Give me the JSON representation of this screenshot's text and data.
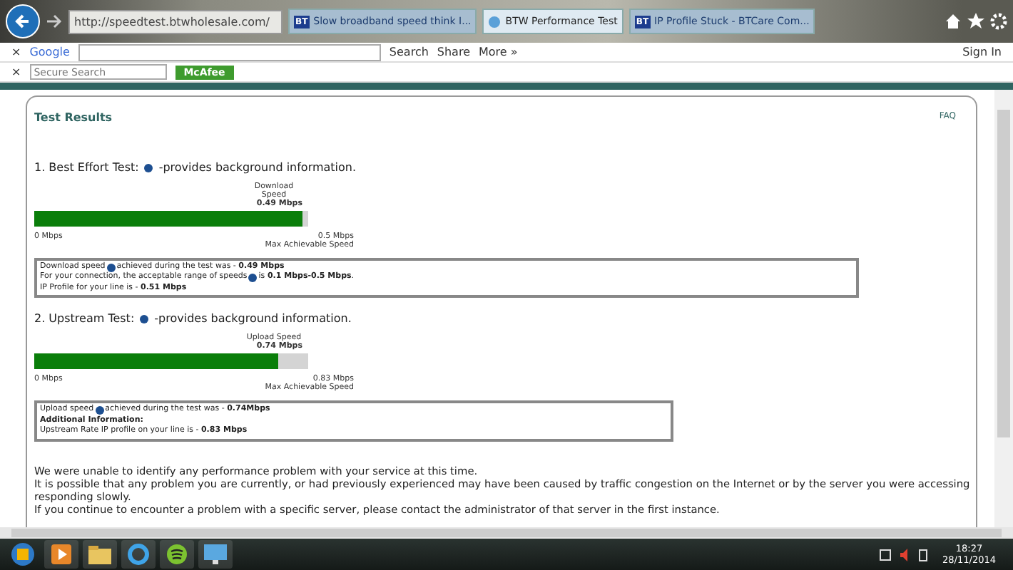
{
  "browser": {
    "address": "http://speedtest.btwholesale.com/",
    "tabs": [
      {
        "label": "Slow broadband speed think I...",
        "selected": false,
        "badge": "BT"
      },
      {
        "label": "BTW Performance Test",
        "selected": true
      },
      {
        "label": "IP Profile Stuck - BTCare Com...",
        "selected": false,
        "badge": "BT"
      }
    ]
  },
  "google_toolbar": {
    "close": "×",
    "brand": "Google",
    "search": "Search",
    "share": "Share",
    "more": "More »",
    "sign_in": "Sign In"
  },
  "mcafee_toolbar": {
    "close": "×",
    "placeholder": "Secure Search",
    "brand": "McAfee"
  },
  "page": {
    "title": "Test Results",
    "faq": "FAQ",
    "tests": [
      {
        "heading": "1. Best Effort Test:",
        "heading_after": "-provides background information.",
        "speed_label": "Download Speed",
        "speed": "0.49 Mbps",
        "level": 0.98,
        "min": "0 Mbps",
        "max": "0.5 Mbps",
        "max_label": "Max Achievable Speed",
        "lines": [
          {
            "text": "Download speed",
            "info_icon": true,
            "after": "achieved during the test was - **0.49 Mbps**"
          },
          {
            "text": "For your connection, the acceptable range of speeds",
            "info_icon": true,
            "after": "is **0.1 Mbps-0.5 Mbps**."
          },
          {
            "text": "IP Profile for your line is - **0.51 Mbps**",
            "info_icon": false
          }
        ]
      },
      {
        "heading": "2. Upstream Test:",
        "heading_after": "-provides background information.",
        "speed_label": "Upload Speed",
        "speed": "0.74 Mbps",
        "level": 0.89,
        "min": "0 Mbps",
        "max": "0.83 Mbps",
        "max_label": "Max Achievable Speed",
        "lines": [
          {
            "text": "Upload speed",
            "info_icon": true,
            "after": "achieved during the test was - **0.74Mbps**"
          },
          {
            "text": "Additional Information:",
            "info_icon": false,
            "bold": true
          },
          {
            "text": "Upstream Rate IP profile on your line is - **0.83 Mbps**",
            "info_icon": false
          }
        ]
      }
    ],
    "paragraphs": [
      "We were unable to identify any performance problem with your service at this time.",
      "It is possible that any problem you are currently, or had previously experienced may have been caused by traffic congestion on the Internet or by the server you were accessing responding slowly.",
      "If you continue to encounter a problem with a specific server, please contact the administrator of that server in the first instance."
    ]
  },
  "taskbar": {
    "time": "18:27",
    "date": "28/11/2014"
  }
}
